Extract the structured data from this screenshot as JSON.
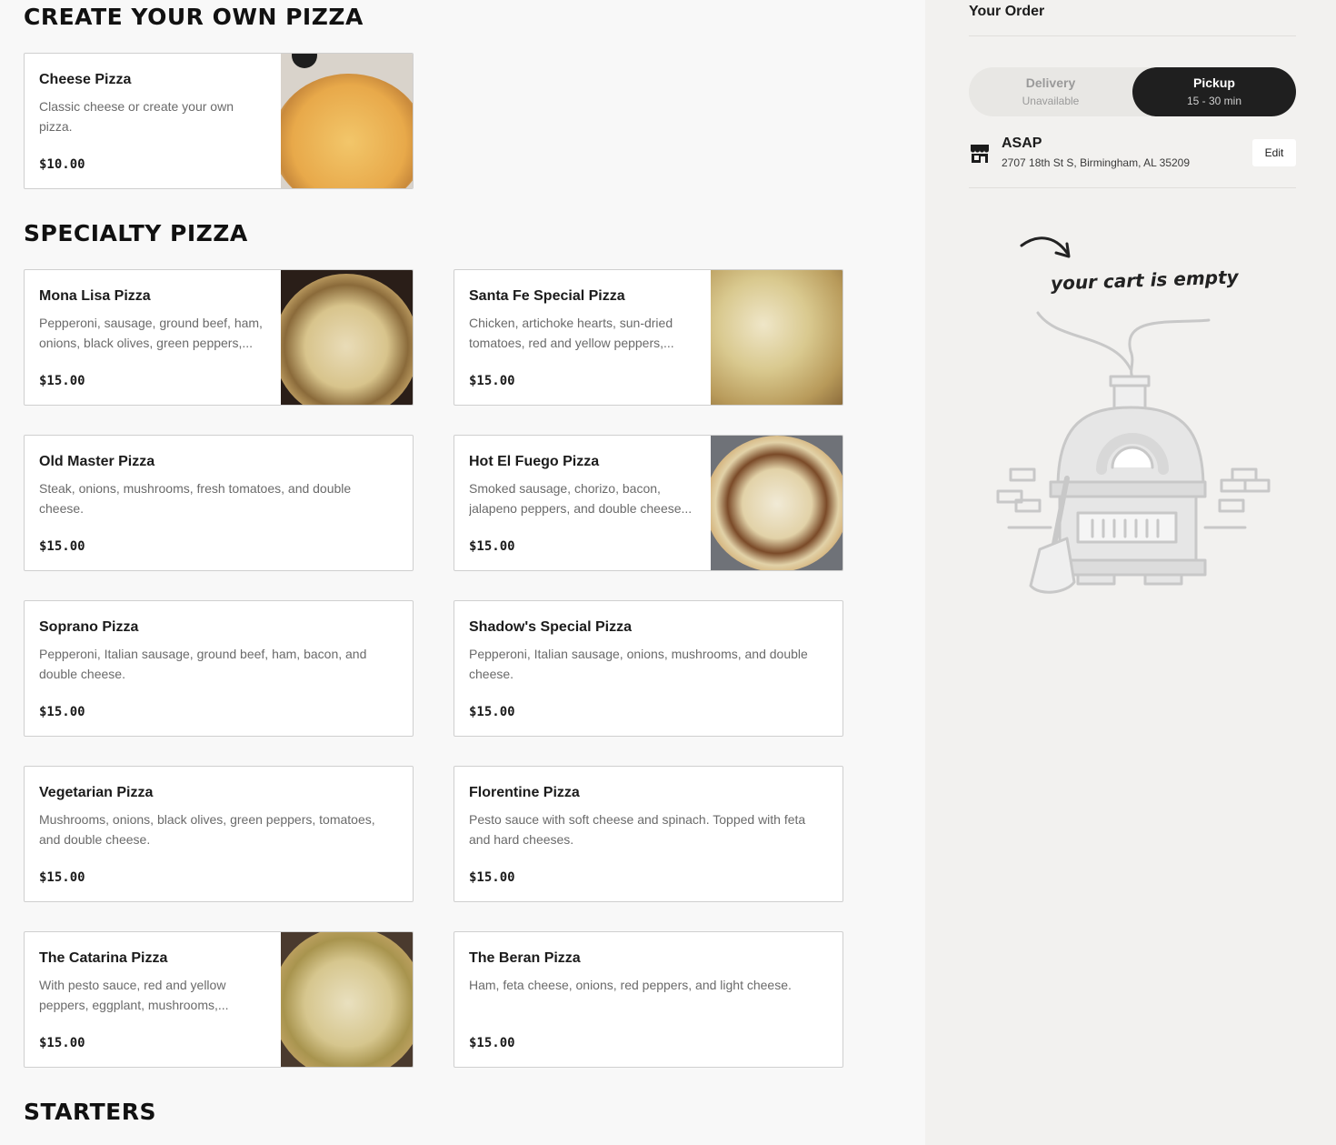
{
  "sections": [
    {
      "title": "CREATE YOUR OWN PIZZA"
    },
    {
      "title": "SPECIALTY PIZZA"
    },
    {
      "title": "STARTERS"
    }
  ],
  "items": [
    {
      "name": "Cheese Pizza",
      "desc": "Classic cheese or create your own pizza.",
      "price": "$10.00"
    },
    {
      "name": "Mona Lisa Pizza",
      "desc": "Pepperoni, sausage, ground beef, ham, onions, black olives, green peppers,...",
      "price": "$15.00"
    },
    {
      "name": "Santa Fe Special Pizza",
      "desc": "Chicken, artichoke hearts, sun-dried tomatoes, red and yellow peppers,...",
      "price": "$15.00"
    },
    {
      "name": "Old Master Pizza",
      "desc": "Steak, onions, mushrooms, fresh tomatoes, and double cheese.",
      "price": "$15.00"
    },
    {
      "name": "Hot El Fuego Pizza",
      "desc": "Smoked sausage, chorizo, bacon, jalapeno peppers, and double cheese...",
      "price": "$15.00"
    },
    {
      "name": "Soprano Pizza",
      "desc": "Pepperoni, Italian sausage, ground beef, ham, bacon, and double cheese.",
      "price": "$15.00"
    },
    {
      "name": "Shadow's Special Pizza",
      "desc": "Pepperoni, Italian sausage, onions, mushrooms, and double cheese.",
      "price": "$15.00"
    },
    {
      "name": "Vegetarian Pizza",
      "desc": "Mushrooms, onions, black olives, green peppers, tomatoes, and double cheese.",
      "price": "$15.00"
    },
    {
      "name": "Florentine Pizza",
      "desc": "Pesto sauce with soft cheese and spinach. Topped with feta and hard cheeses.",
      "price": "$15.00"
    },
    {
      "name": "The Catarina Pizza",
      "desc": "With pesto sauce, red and yellow peppers, eggplant, mushrooms,...",
      "price": "$15.00"
    },
    {
      "name": "The Beran Pizza",
      "desc": "Ham, feta cheese, onions, red peppers, and light cheese.",
      "price": "$15.00"
    }
  ],
  "order": {
    "title": "Your Order",
    "delivery_label": "Delivery",
    "delivery_sub": "Unavailable",
    "pickup_label": "Pickup",
    "pickup_sub": "15 - 30 min",
    "time": "ASAP",
    "address": "2707 18th St S, Birmingham, AL 35209",
    "edit_label": "Edit",
    "empty_text": "your cart is empty"
  }
}
